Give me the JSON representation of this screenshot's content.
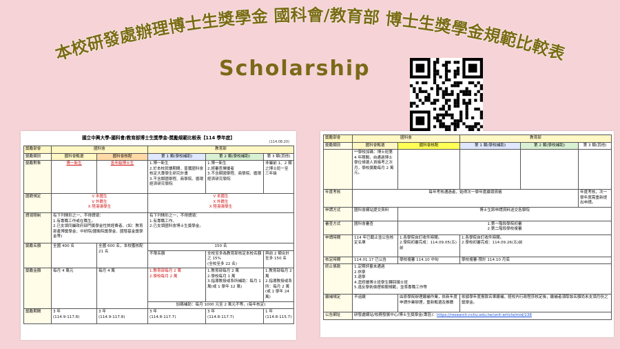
{
  "banner": {
    "title_left": "本校研發處辦理博士生獎學金 國科會/教育部 博士生獎學金規範比較表",
    "subtitle": "Scholarship"
  },
  "colors": {
    "title_fill": "#7a6b14",
    "title_stroke": "#ffffff",
    "background": "#f6d3d7"
  },
  "icons": {
    "qr": "qr-code-icon"
  },
  "sheet1": {
    "title": "國立中興大學-國科會/教育部博士生獎學金-奬勵規範比較表【114 學年度】",
    "date": "(114.08.20)",
    "row_dept": {
      "label": "獎勵部會",
      "nstc": "國科會",
      "moe": "教育部"
    },
    "row_type": {
      "label": "獎勵類別",
      "c1": "國科會甄選",
      "c2": "國科會核配",
      "c3": "第 1 類(學校補助)",
      "c4": "第 2 類(學校補助)",
      "c5": "第 3 類(其他)"
    },
    "row_target": {
      "label": "獎勵對象",
      "c1": "博一新生",
      "c2": "各年級博士生",
      "c3": "1.博一新生\n2.於本校就讀期間，曾獲國科會核定大專學生研究計畫\n3.不含鄰國學程、商學院、循環經濟研究學院",
      "c4": "1.博一新生\n2.經審查擇優者\n3.不含鄰國學程、商學院、循環經濟研究學院",
      "c5": "非屬前 1、2 類之博士班一至三年級"
    },
    "row_nation": {
      "label": "國籍規定",
      "nstc": "V 本國生\nV 外籍生\nX 陸港澳學生",
      "moe": "V 本國生\nX 外籍生\nX 陸港澳學生"
    },
    "row_restrict": {
      "label": "請領限制",
      "nstc": "有下列情形之一，不得請領：\n1.有專職工作或在職生。\n2.已支領同屬政府部門獎學金性質經費者。(如：教育部產博獎學金、中研院/國衛院獎學金、國發基金獎學金等)",
      "moe": "有下列情形之一，不得請領：\n1.有專職工作。\n2.已支領國科會博士生獎學金。"
    },
    "row_quota": {
      "label": "獎勵名額",
      "c1": "全國 400 名",
      "c2": "全國 600 名，本校獲核配 21 名",
      "c3": "不限名額",
      "c4": "全校至多為教育部核定本校名額之 15%\n(全校至多 22 名)",
      "c5": "與前 2 類合計至多 150 名",
      "moe_total": "150 名"
    },
    "row_amount": {
      "label": "獎勵金額",
      "c1": "每月 4 萬元",
      "c2": "每月 4 萬",
      "c3": "1.教育部每月 2 萬\n2.學校每月 2 萬",
      "c4": "1.教育部每月 2 萬\n2.學校每月 1 萬\n3.指導教授或系所補助：每月 1 萬(或 1 學年 12 萬)",
      "c5": "1.教育部每月 2 萬\n2.指導教授或系所：每月 2 萬(或 1 學年 24 萬)",
      "note": "加碼補助：每月 1000 元至 2 萬元不等，(每年核定)"
    },
    "row_period": {
      "label": "獎勵期間",
      "c1": "3 年\n(114.9-117.8)",
      "c2": "3 年\n(114.9-117.8)",
      "c3": "3 年\n(114.8-117.7)",
      "c4": "3 年\n(114.8-117.7)",
      "c5": "1 年\n(114.8-115.7)"
    }
  },
  "sheet2": {
    "row_dept": {
      "label": "獎勵部會",
      "nstc": "國科會",
      "moe": "教育部"
    },
    "row_type": {
      "label": "獎勵類別",
      "c1": "國科會甄選",
      "c2": "國科會核配",
      "c3": "第 1 類(學校補助)",
      "c4": "第 2 類(學校補助)",
      "c5": "第 3 類(其他)"
    },
    "row_extra": {
      "c1": "**學校加碼：博士班第 4 年期間，自通過博士學位候選人資格考之次月，學校獎勵每月 2 萬元。"
    },
    "row_annual": {
      "label": "年度考核",
      "nstc": "每年考核通過者，始得次一學年度續領資格",
      "c5": "年度考核，次一學年度需重新提出申請。"
    },
    "row_method": {
      "label": "申請方式",
      "nstc": "國科會網站提交資料",
      "moe": "博士生將申請資料送交各學院"
    },
    "row_review": {
      "label": "審查方式",
      "nstc": "國科會審查",
      "moe": "1.第一階段學院初審\n2.第二階段學校複審"
    },
    "row_time": {
      "label": "申請時間",
      "c1": "114 年已截止並公告核定名單",
      "c2": "1.各學院自訂收件時間。\n2.學院初審完成：114.09.05(五)前",
      "moe": "1.各學院自訂收件時間。\n2.學校初審完成：114.09.26(五)前"
    },
    "row_approve": {
      "label": "核定時間",
      "c1": "114.01.17 已公告",
      "c2": "學校複審 114.10 中旬",
      "moe": "學校複審-預計 114.10 月底"
    },
    "row_terminate": {
      "label": "終止條款",
      "text": "1.定期評量未通過\n2.休學\n3.退學\n4.逕修讀博士班學生轉回碩士班\n5.違反學術倫理相關規範，並準專職工作等"
    },
    "row_repay": {
      "label": "繳補規定",
      "c1": "不追繳",
      "c2": "由原學院辦理繳補作業，依新年度申請作業辦理，重新甄選及推薦",
      "moe": "依據學年度撥款名單繳補，經校內行政程序核定後，繳補者須取該名額尚未支領月份之獎學金。"
    },
    "row_url": {
      "label": "公告網址",
      "text": "研發處網站/校務發展中心/博士生獎學金(專區)：",
      "url": "https://research.nchu.edu.tw/unit-article/mid/138"
    }
  }
}
